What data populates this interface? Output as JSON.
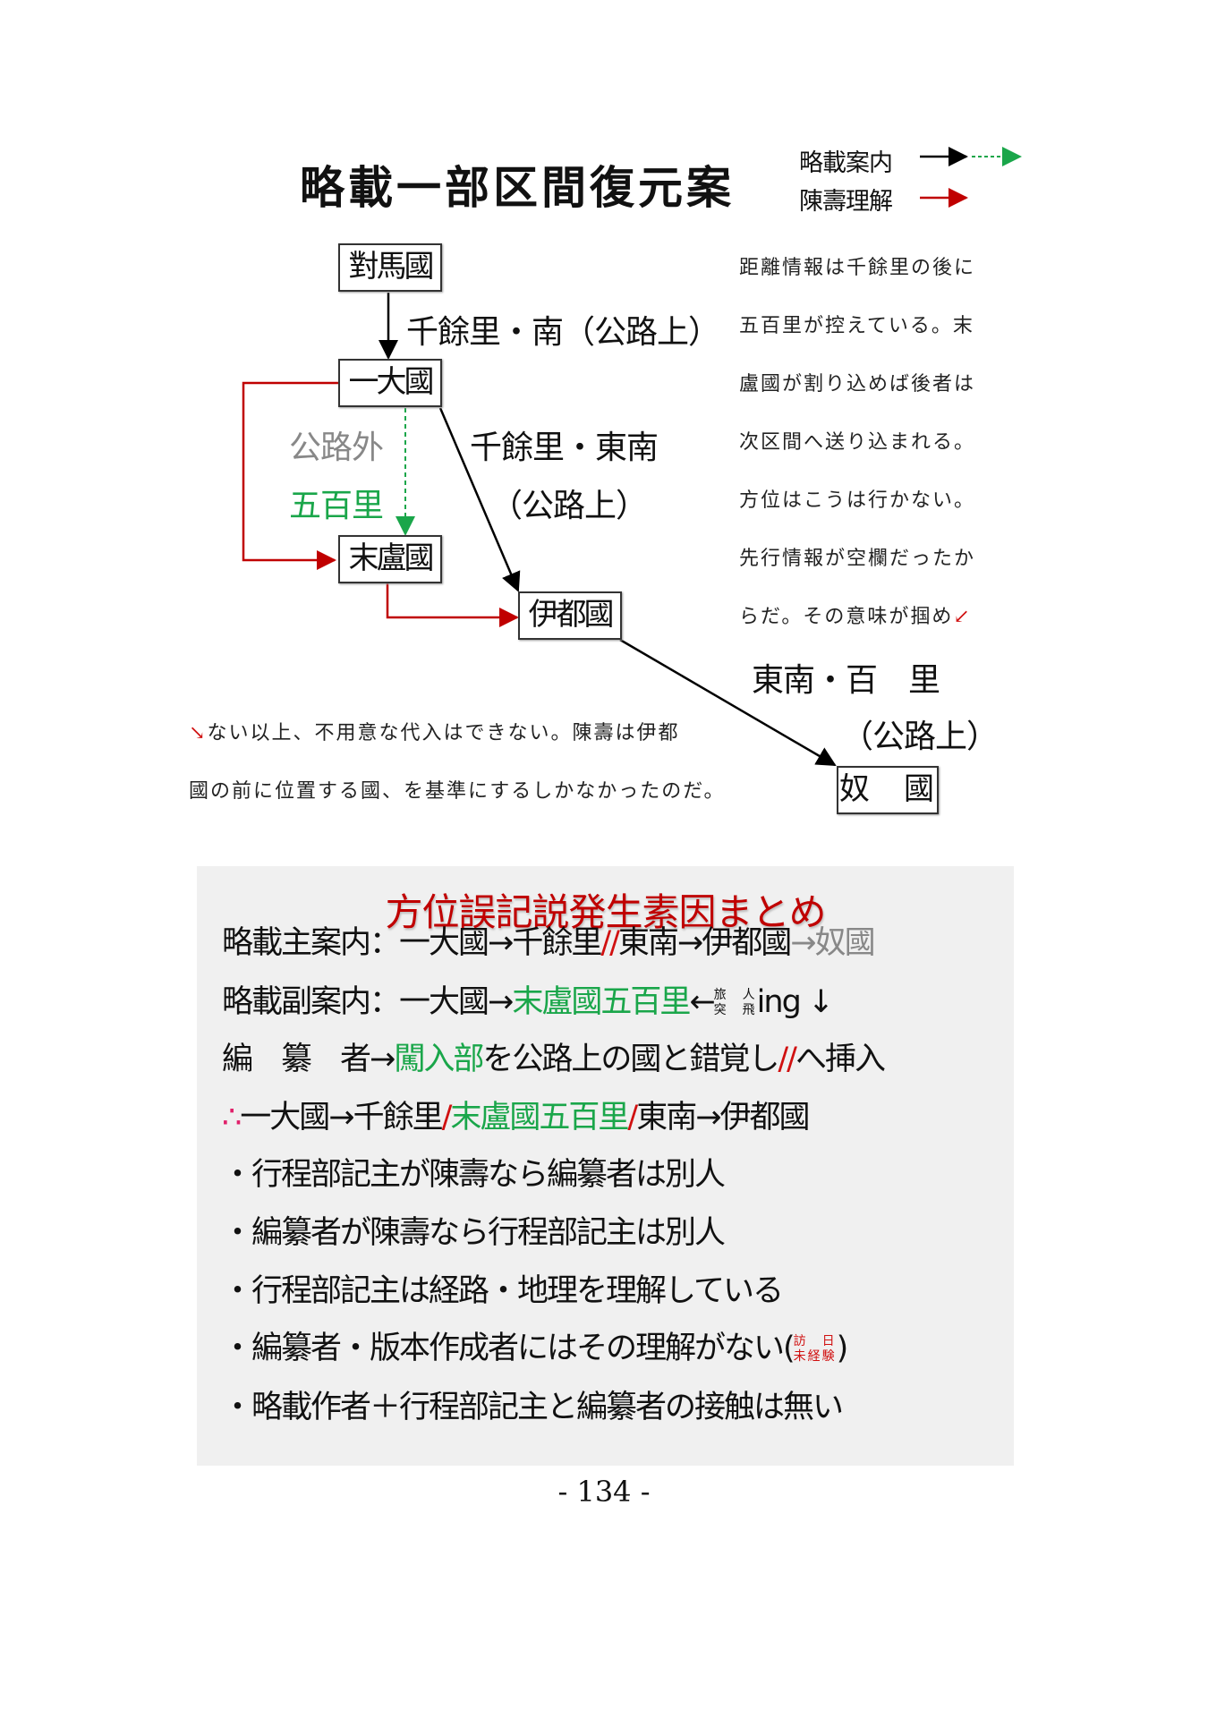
{
  "title": "略載一部区間復元案",
  "legend": {
    "guide": "略載案内",
    "chenshou": "陳壽理解"
  },
  "colors": {
    "green": "#1aa64a",
    "red": "#c00000",
    "gray": "#888888"
  },
  "diagram": {
    "nodes": {
      "tsushima": "對馬國",
      "ichidai": "一大國",
      "matsura": "末盧國",
      "ito": "伊都國",
      "na": "奴　國"
    },
    "labels": {
      "tsushima_ichidai": "千餘里・南（公路上）",
      "offroad": "公路外",
      "gohyakuri": "五百里",
      "ichidai_ito_1": "千餘里・東南",
      "ichidai_ito_2": "（公路上）",
      "ito_na_1": "東南・百　里",
      "ito_na_2": "（公路上）"
    }
  },
  "side_text": [
    "距離情報は千餘里の後に",
    "五百里が控えている。末",
    "盧國が割り込めば後者は",
    "次区間へ送り込まれる。",
    "方位はこうは行かない。",
    "先行情報が空欄だったか",
    "らだ。その意味が掴め"
  ],
  "side_text_mark": "↙",
  "bottom_text_mark": "↘",
  "bottom_text": [
    "ない以上、不用意な代入はできない。陳壽は伊都",
    "國の前に位置する國、を基準にするしかなかったのだ。"
  ],
  "summary": {
    "heading": "方位誤記説発生素因まとめ",
    "lines": [
      [
        {
          "t": "略載主案内：一大國→千餘里"
        },
        {
          "t": "//",
          "c": "red"
        },
        {
          "t": "東南→伊都國"
        },
        {
          "t": "→奴國",
          "c": "gray"
        }
      ],
      [
        {
          "t": "略載副案内：一大國→"
        },
        {
          "t": "末盧國五百里",
          "c": "green"
        },
        {
          "t": "←"
        },
        {
          "stack": [
            "旅　人",
            "突　飛"
          ]
        },
        {
          "t": "ing",
          "c": "serif"
        },
        {
          "t": " ↓"
        }
      ],
      [
        {
          "t": "編　纂　者→"
        },
        {
          "t": "闖入部",
          "c": "green"
        },
        {
          "t": "を公路上の國と錯覚し"
        },
        {
          "t": "//",
          "c": "red"
        },
        {
          "t": "へ挿入"
        }
      ],
      [
        {
          "t": "∴",
          "c": "pink"
        },
        {
          "t": "一大國→千餘里"
        },
        {
          "t": "/",
          "c": "red"
        },
        {
          "t": "末盧國五百里",
          "c": "green"
        },
        {
          "t": "/",
          "c": "red"
        },
        {
          "t": "東南→伊都國"
        }
      ],
      [
        {
          "t": "・行程部記主が陳壽なら編纂者は別人"
        }
      ],
      [
        {
          "t": "・編纂者が陳壽なら行程部記主は別人"
        }
      ],
      [
        {
          "t": "・行程部記主は経路・地理を理解している"
        }
      ],
      [
        {
          "t": "・編纂者・版本作成者にはその理解がない("
        },
        {
          "stack": [
            "訪　日",
            "未経験"
          ],
          "c": "red"
        },
        {
          "t": ")"
        }
      ],
      [
        {
          "t": "・略載作者＋行程部記主と編纂者の接触は無い"
        }
      ]
    ]
  },
  "page_number": "- 134 -"
}
